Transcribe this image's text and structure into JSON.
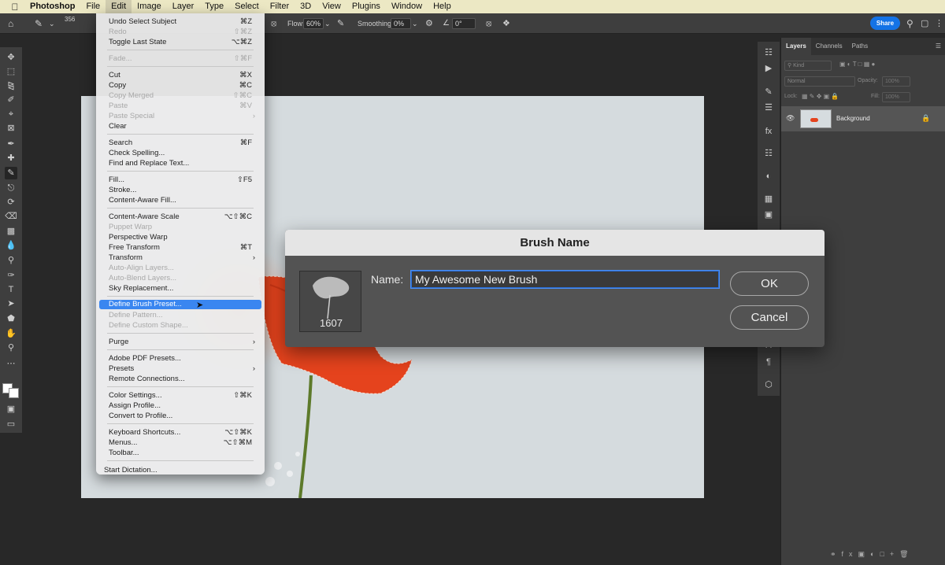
{
  "menubar": {
    "apple_icon": "apple-icon",
    "items": [
      "Photoshop",
      "File",
      "Edit",
      "Image",
      "Layer",
      "Type",
      "Select",
      "Filter",
      "3D",
      "View",
      "Plugins",
      "Window",
      "Help"
    ],
    "active": "Edit"
  },
  "options_bar": {
    "brush_size": "356",
    "flow_label": "Flow:",
    "flow_value": "60%",
    "smoothing_label": "Smoothing:",
    "smoothing_value": "0%",
    "angle_value": "0°",
    "share_label": "Share"
  },
  "edit_menu": {
    "groups": [
      [
        {
          "label": "Undo Select Subject",
          "shortcut": "⌘Z",
          "disabled": false
        },
        {
          "label": "Redo",
          "shortcut": "⇧⌘Z",
          "disabled": true
        },
        {
          "label": "Toggle Last State",
          "shortcut": "⌥⌘Z",
          "disabled": false
        }
      ],
      [
        {
          "label": "Fade...",
          "shortcut": "⇧⌘F",
          "disabled": true
        }
      ],
      [
        {
          "label": "Cut",
          "shortcut": "⌘X",
          "disabled": false
        },
        {
          "label": "Copy",
          "shortcut": "⌘C",
          "disabled": false
        },
        {
          "label": "Copy Merged",
          "shortcut": "⇧⌘C",
          "disabled": true
        },
        {
          "label": "Paste",
          "shortcut": "⌘V",
          "disabled": true
        },
        {
          "label": "Paste Special",
          "shortcut": "",
          "submenu": true,
          "disabled": true
        },
        {
          "label": "Clear",
          "shortcut": "",
          "disabled": false
        }
      ],
      [
        {
          "label": "Search",
          "shortcut": "⌘F",
          "disabled": false
        },
        {
          "label": "Check Spelling...",
          "shortcut": "",
          "disabled": false
        },
        {
          "label": "Find and Replace Text...",
          "shortcut": "",
          "disabled": false
        }
      ],
      [
        {
          "label": "Fill...",
          "shortcut": "⇧F5",
          "disabled": false
        },
        {
          "label": "Stroke...",
          "shortcut": "",
          "disabled": false
        },
        {
          "label": "Content-Aware Fill...",
          "shortcut": "",
          "disabled": false
        }
      ],
      [
        {
          "label": "Content-Aware Scale",
          "shortcut": "⌥⇧⌘C",
          "disabled": false
        },
        {
          "label": "Puppet Warp",
          "shortcut": "",
          "disabled": true
        },
        {
          "label": "Perspective Warp",
          "shortcut": "",
          "disabled": false
        },
        {
          "label": "Free Transform",
          "shortcut": "⌘T",
          "disabled": false
        },
        {
          "label": "Transform",
          "shortcut": "",
          "submenu": true,
          "disabled": false
        },
        {
          "label": "Auto-Align Layers...",
          "shortcut": "",
          "disabled": true
        },
        {
          "label": "Auto-Blend Layers...",
          "shortcut": "",
          "disabled": true
        },
        {
          "label": "Sky Replacement...",
          "shortcut": "",
          "disabled": false
        }
      ],
      [
        {
          "label": "Define Brush Preset...",
          "shortcut": "",
          "disabled": false,
          "highlighted": true
        },
        {
          "label": "Define Pattern...",
          "shortcut": "",
          "disabled": true
        },
        {
          "label": "Define Custom Shape...",
          "shortcut": "",
          "disabled": true
        }
      ],
      [
        {
          "label": "Purge",
          "shortcut": "",
          "submenu": true,
          "disabled": false
        }
      ],
      [
        {
          "label": "Adobe PDF Presets...",
          "shortcut": "",
          "disabled": false
        },
        {
          "label": "Presets",
          "shortcut": "",
          "submenu": true,
          "disabled": false
        },
        {
          "label": "Remote Connections...",
          "shortcut": "",
          "disabled": false
        }
      ],
      [
        {
          "label": "Color Settings...",
          "shortcut": "⇧⌘K",
          "disabled": false
        },
        {
          "label": "Assign Profile...",
          "shortcut": "",
          "disabled": false
        },
        {
          "label": "Convert to Profile...",
          "shortcut": "",
          "disabled": false
        }
      ],
      [
        {
          "label": "Keyboard Shortcuts...",
          "shortcut": "⌥⇧⌘K",
          "disabled": false
        },
        {
          "label": "Menus...",
          "shortcut": "⌥⇧⌘M",
          "disabled": false
        },
        {
          "label": "Toolbar...",
          "shortcut": "",
          "disabled": false
        }
      ]
    ],
    "dictation": "Start Dictation..."
  },
  "dialog": {
    "title": "Brush Name",
    "name_label": "Name:",
    "name_value": "My Awesome New Brush",
    "brush_size": "1607",
    "ok_label": "OK",
    "cancel_label": "Cancel"
  },
  "layers_panel": {
    "tabs": [
      "Layers",
      "Channels",
      "Paths"
    ],
    "active_tab": "Layers",
    "filter_placeholder": "Kind",
    "blend_mode": "Normal",
    "opacity_label": "Opacity:",
    "opacity_value": "100%",
    "lock_label": "Lock:",
    "fill_label": "Fill:",
    "fill_value": "100%",
    "layers": [
      {
        "name": "Background",
        "locked": true,
        "visible": true
      }
    ]
  },
  "colors": {
    "accent": "#1473e6",
    "menu_highlight": "#3a86f0",
    "poppy": "#e5431d"
  }
}
